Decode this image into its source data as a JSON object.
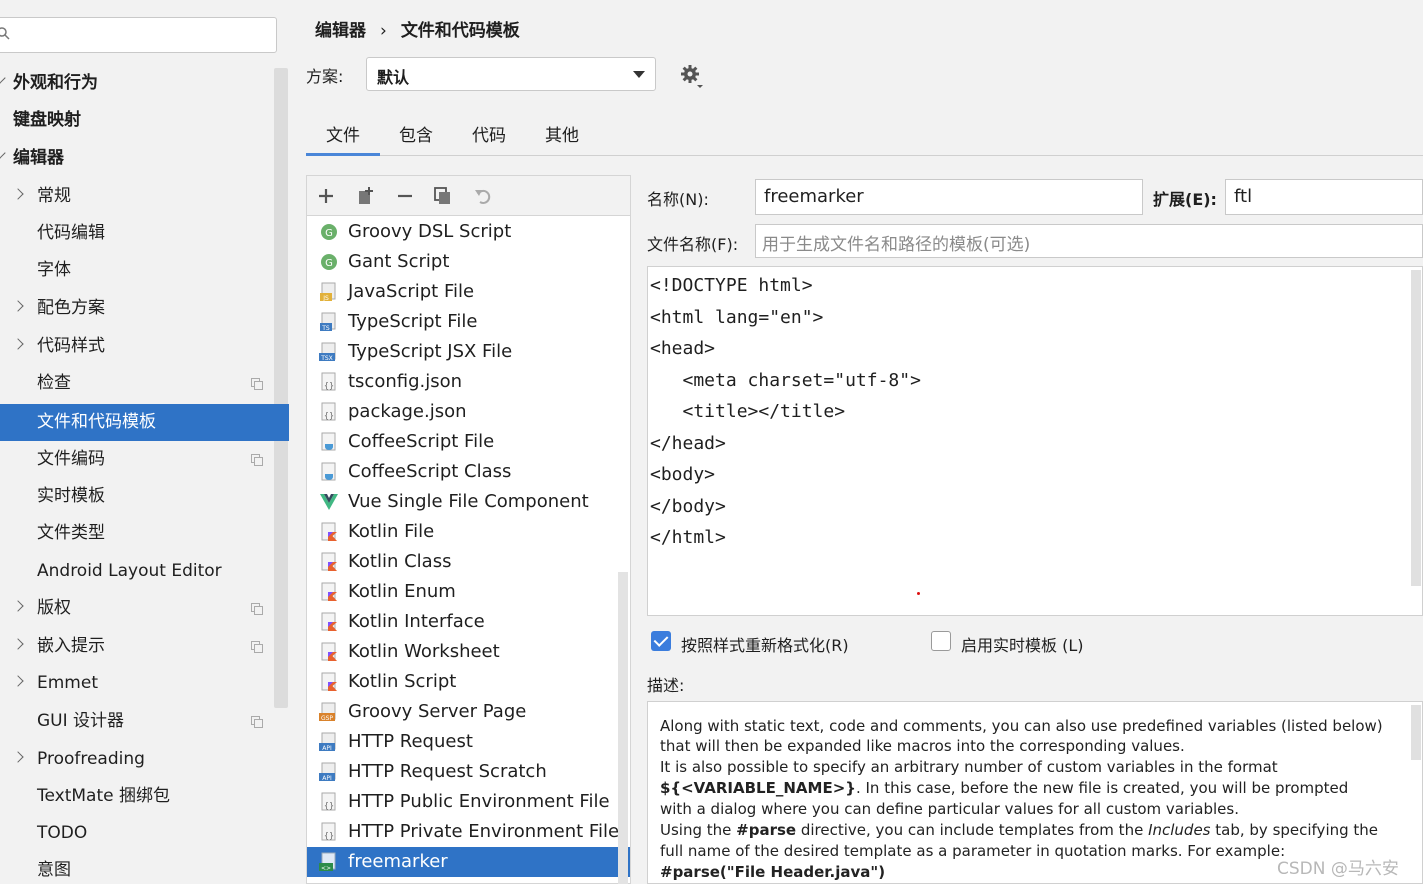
{
  "sidebar": {
    "search_placeholder": "",
    "items": [
      {
        "label": "外观和行为",
        "bold": true
      },
      {
        "label": "键盘映射",
        "bold": true
      },
      {
        "label": "编辑器",
        "bold": true
      },
      {
        "label": "常规"
      },
      {
        "label": "代码编辑"
      },
      {
        "label": "字体"
      },
      {
        "label": "配色方案"
      },
      {
        "label": "代码样式"
      },
      {
        "label": "检查"
      },
      {
        "label": "文件和代码模板",
        "selected": true
      },
      {
        "label": "文件编码"
      },
      {
        "label": "实时模板"
      },
      {
        "label": "文件类型"
      },
      {
        "label": "Android Layout Editor"
      },
      {
        "label": "版权"
      },
      {
        "label": "嵌入提示"
      },
      {
        "label": "Emmet"
      },
      {
        "label": "GUI 设计器"
      },
      {
        "label": "Proofreading"
      },
      {
        "label": "TextMate 捆绑包"
      },
      {
        "label": "TODO"
      },
      {
        "label": "意图"
      }
    ]
  },
  "breadcrumb": {
    "parent": "编辑器",
    "separator": "›",
    "current": "文件和代码模板"
  },
  "scheme": {
    "label": "方案:",
    "value": "默认"
  },
  "tabs": [
    "文件",
    "包含",
    "代码",
    "其他"
  ],
  "templates": [
    {
      "label": "Groovy DSL Script",
      "icon": "groovy-icon"
    },
    {
      "label": "Gant Script",
      "icon": "groovy-icon"
    },
    {
      "label": "JavaScript File",
      "icon": "javascript-file-icon"
    },
    {
      "label": "TypeScript File",
      "icon": "typescript-file-icon"
    },
    {
      "label": "TypeScript JSX File",
      "icon": "tsx-file-icon"
    },
    {
      "label": "tsconfig.json",
      "icon": "json-file-icon"
    },
    {
      "label": "package.json",
      "icon": "json-file-icon"
    },
    {
      "label": "CoffeeScript File",
      "icon": "coffeescript-file-icon"
    },
    {
      "label": "CoffeeScript Class",
      "icon": "coffeescript-file-icon"
    },
    {
      "label": "Vue Single File Component",
      "icon": "vue-icon"
    },
    {
      "label": "Kotlin File",
      "icon": "kotlin-file-icon"
    },
    {
      "label": "Kotlin Class",
      "icon": "kotlin-file-icon"
    },
    {
      "label": "Kotlin Enum",
      "icon": "kotlin-file-icon"
    },
    {
      "label": "Kotlin Interface",
      "icon": "kotlin-file-icon"
    },
    {
      "label": "Kotlin Worksheet",
      "icon": "kotlin-file-icon"
    },
    {
      "label": "Kotlin Script",
      "icon": "kotlin-file-icon"
    },
    {
      "label": "Groovy Server Page",
      "icon": "gsp-file-icon"
    },
    {
      "label": "HTTP Request",
      "icon": "api-file-icon"
    },
    {
      "label": "HTTP Request Scratch",
      "icon": "api-file-icon"
    },
    {
      "label": "HTTP Public Environment File",
      "icon": "json-file-icon"
    },
    {
      "label": "HTTP Private Environment File",
      "icon": "json-file-icon"
    },
    {
      "label": "freemarker",
      "icon": "freemarker-file-icon",
      "selected": true
    }
  ],
  "editor": {
    "name_label": "名称(N):",
    "name_value": "freemarker",
    "ext_label": "扩展(E):",
    "ext_value": "ftl",
    "filename_label": "文件名称(F):",
    "filename_placeholder": "用于生成文件名和路径的模板(可选)",
    "code_lines": [
      "<!DOCTYPE html>",
      "<html lang=\"en\">",
      "<head>",
      "   <meta charset=\"utf-8\">",
      "   <title></title>",
      "</head>",
      "<body>",
      "</body>",
      "</html>"
    ],
    "reformat_label": "按照样式重新格式化(R)",
    "reformat_checked": true,
    "live_template_label": "启用实时模板 (L)",
    "live_template_checked": false,
    "description_label": "描述:"
  },
  "description": {
    "line1": "Along with static text, code and comments, you can also use predefined variables (listed below)",
    "line2": "that will then be expanded like macros into the corresponding values.",
    "line3": "It is also possible to specify an arbitrary number of custom variables in the format",
    "line4_bold": "${<VARIABLE_NAME>}",
    "line4_rest": ". In this case, before the new file is created, you will be prompted",
    "line5": "with a dialog where you can define particular values for all custom variables.",
    "line6_a": "Using the ",
    "line6_bold": "#parse",
    "line6_b": " directive, you can include templates from the ",
    "line6_italic": "Includes",
    "line6_c": " tab, by specifying the",
    "line7": "full name of the desired template as a parameter in quotation marks. For example:",
    "line8_bold": "#parse(\"File Header.java\")"
  },
  "watermark": "CSDN @马六安",
  "colors": {
    "accent": "#2f73c6",
    "checkbox": "#3b7ddd"
  }
}
